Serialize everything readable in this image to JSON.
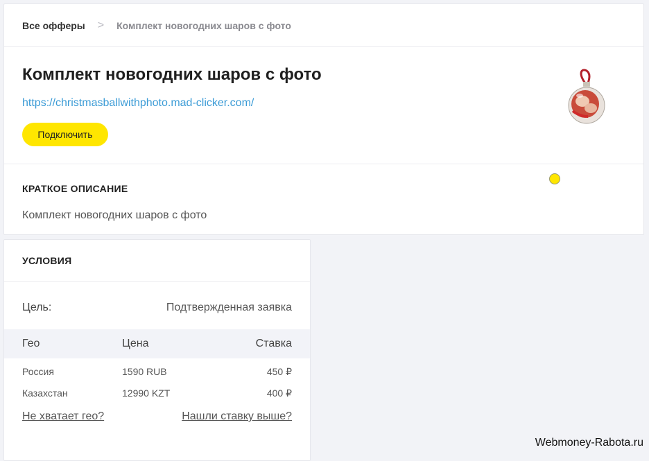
{
  "breadcrumb": {
    "home": "Все офферы",
    "separator": ">",
    "current": "Комплект новогодних шаров с фото"
  },
  "offer": {
    "title": "Комплект новогодних шаров с фото",
    "url": "https://christmasballwithphoto.mad-clicker.com/",
    "connect_label": "Подключить"
  },
  "description": {
    "title": "КРАТКОЕ ОПИСАНИЕ",
    "text": "Комплект новогодних шаров с фото"
  },
  "terms": {
    "title": "УСЛОВИЯ",
    "goal_label": "Цель:",
    "goal_value": "Подтвержденная заявка",
    "columns": [
      "Гео",
      "Цена",
      "Ставка"
    ],
    "rows": [
      {
        "geo": "Россия",
        "price": "1590 RUB",
        "rate": "450 ₽"
      },
      {
        "geo": "Казахстан",
        "price": "12990 KZT",
        "rate": "400 ₽"
      }
    ],
    "missing_geo_link": "Не хватает гео?",
    "higher_rate_link": "Нашли ставку выше?"
  },
  "watermark": "Webmoney-Rabota.ru",
  "colors": {
    "accent_yellow": "#ffe600",
    "link_blue": "#3b9bd6"
  }
}
